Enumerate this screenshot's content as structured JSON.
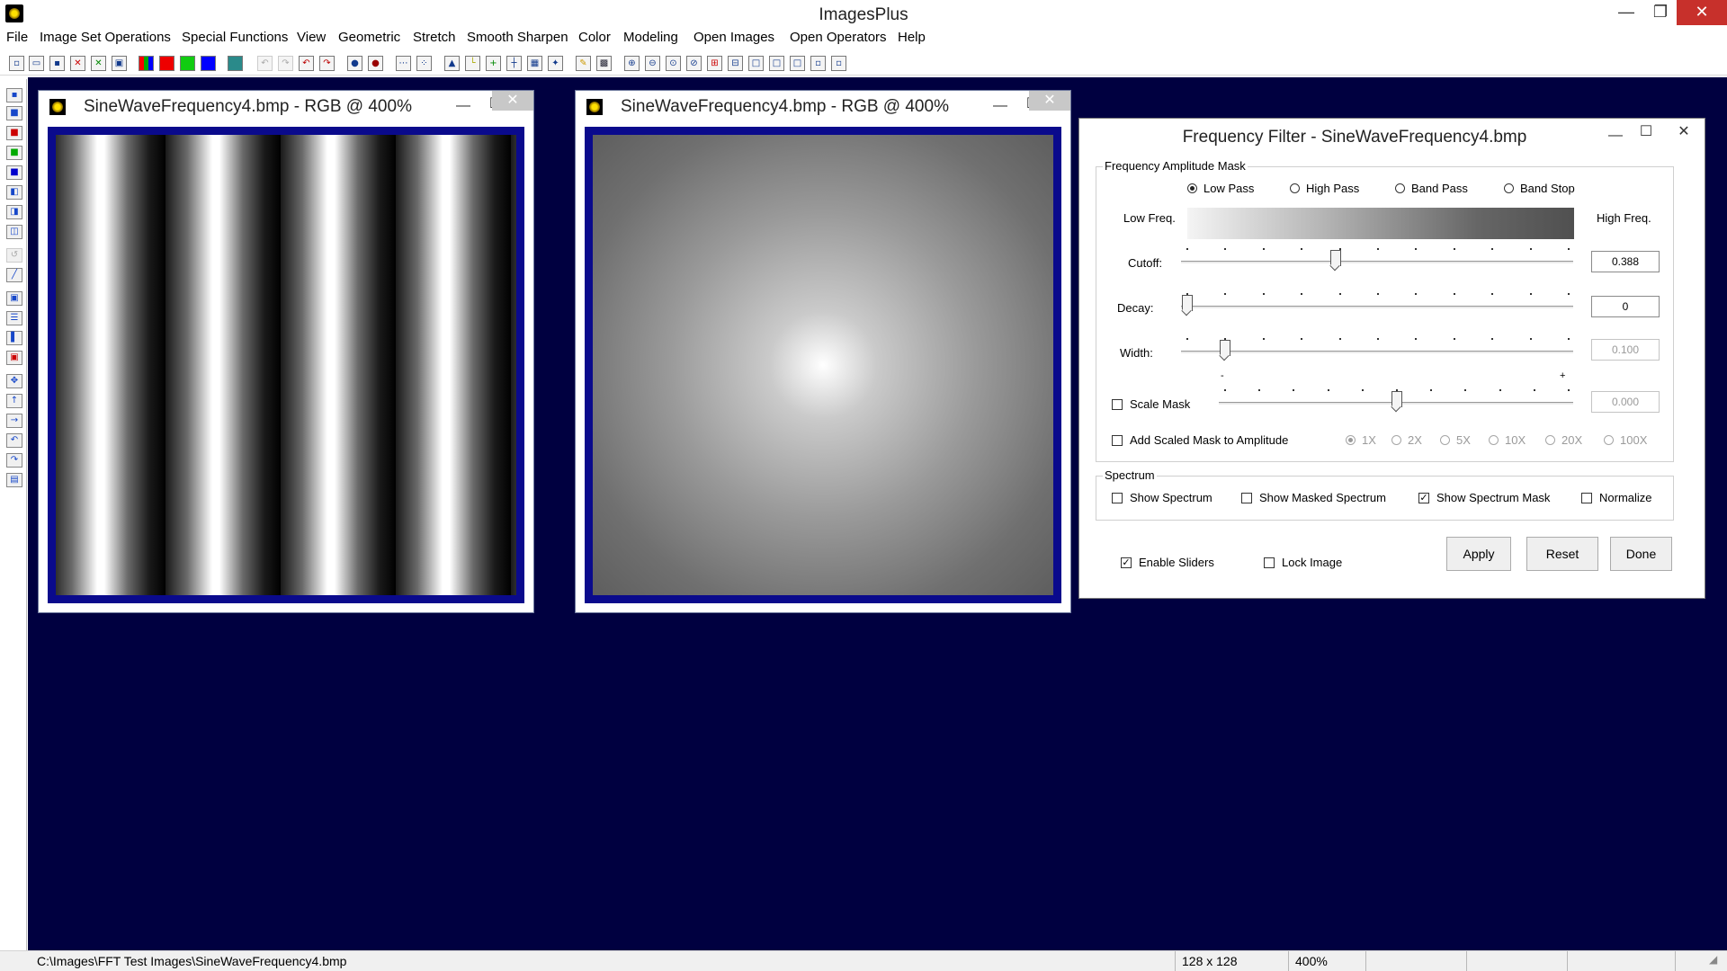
{
  "app": {
    "title": "ImagesPlus",
    "window_controls": {
      "minimize": "—",
      "maximize": "❐",
      "close": "✕"
    }
  },
  "menu": [
    "File",
    "Image Set Operations",
    "Special Functions",
    "View",
    "Geometric",
    "Stretch",
    "Smooth Sharpen",
    "Color",
    "Modeling",
    "Open Images",
    "Open Operators",
    "Help"
  ],
  "image_windows": [
    {
      "title": "SineWaveFrequency4.bmp - RGB @ 400%",
      "content": "sine-wave-stripes"
    },
    {
      "title": "SineWaveFrequency4.bmp - RGB @ 400%",
      "content": "radial-frequency-mask"
    }
  ],
  "dialog": {
    "title": "Frequency Filter - SineWaveFrequency4.bmp",
    "mask_group": {
      "label": "Frequency Amplitude Mask",
      "filter_types": [
        {
          "label": "Low Pass",
          "selected": true
        },
        {
          "label": "High Pass",
          "selected": false
        },
        {
          "label": "Band Pass",
          "selected": false
        },
        {
          "label": "Band Stop",
          "selected": false
        }
      ],
      "low_freq_label": "Low Freq.",
      "high_freq_label": "High Freq.",
      "cutoff": {
        "label": "Cutoff:",
        "value": "0.388",
        "position": 0.388,
        "enabled": true
      },
      "decay": {
        "label": "Decay:",
        "value": "0",
        "position": 0,
        "enabled": true
      },
      "width": {
        "label": "Width:",
        "value": "0.100",
        "position": 0.1,
        "enabled": false
      },
      "scale_mask": {
        "label": "Scale Mask",
        "checked": false,
        "value": "0.000",
        "position": 0.5,
        "enabled": false,
        "min_mark": "-",
        "max_mark": "+"
      },
      "add_scaled": {
        "label": "Add Scaled Mask to Amplitude",
        "checked": false
      },
      "multipliers": [
        {
          "label": "1X",
          "selected": true
        },
        {
          "label": "2X",
          "selected": false
        },
        {
          "label": "5X",
          "selected": false
        },
        {
          "label": "10X",
          "selected": false
        },
        {
          "label": "20X",
          "selected": false
        },
        {
          "label": "100X",
          "selected": false
        }
      ]
    },
    "spectrum_group": {
      "label": "Spectrum",
      "options": [
        {
          "label": "Show Spectrum",
          "checked": false
        },
        {
          "label": "Show Masked Spectrum",
          "checked": false
        },
        {
          "label": "Show Spectrum Mask",
          "checked": true
        },
        {
          "label": "Normalize",
          "checked": false
        }
      ]
    },
    "enable_sliders": {
      "label": "Enable Sliders",
      "checked": true
    },
    "lock_image": {
      "label": "Lock Image",
      "checked": false
    },
    "buttons": {
      "apply": "Apply",
      "reset": "Reset",
      "done": "Done"
    }
  },
  "status_bar": {
    "path": "C:\\Images\\FFT Test Images\\SineWaveFrequency4.bmp",
    "dimensions": "128 x 128",
    "zoom": "400%"
  },
  "colors": {
    "workspace": "#000040",
    "image_border": "#0a0a8c",
    "close_button": "#c7302b"
  }
}
